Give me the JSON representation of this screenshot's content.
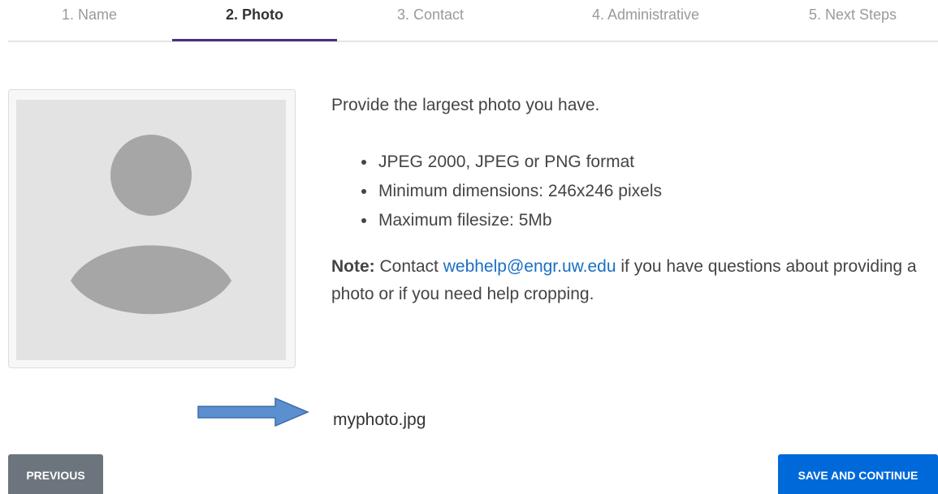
{
  "steps": [
    {
      "label": "1. Name"
    },
    {
      "label": "2. Photo"
    },
    {
      "label": "3. Contact"
    },
    {
      "label": "4. Administrative"
    },
    {
      "label": "5. Next Steps"
    }
  ],
  "active_step": 2,
  "info": {
    "intro": "Provide the largest photo you have.",
    "requirements": [
      "JPEG 2000, JPEG or PNG format",
      "Minimum dimensions: 246x246 pixels",
      "Maximum filesize: 5Mb"
    ],
    "note_label": "Note:",
    "note_prefix": " Contact ",
    "note_email": "webhelp@engr.uw.edu",
    "note_suffix": " if you have questions about providing a photo or if you need help cropping."
  },
  "file": {
    "name": "myphoto.jpg"
  },
  "buttons": {
    "previous": "PREVIOUS",
    "save": "SAVE AND CONTINUE"
  },
  "colors": {
    "accent": "#4b2e83",
    "link": "#1a6fc4",
    "primary_button": "#0069d9",
    "secondary_button": "#6c757d",
    "arrow": "#5b8fcf",
    "placeholder": "#a6a6a6"
  },
  "icons": {
    "avatar": "person-silhouette-icon",
    "arrow": "arrow-right-icon"
  }
}
